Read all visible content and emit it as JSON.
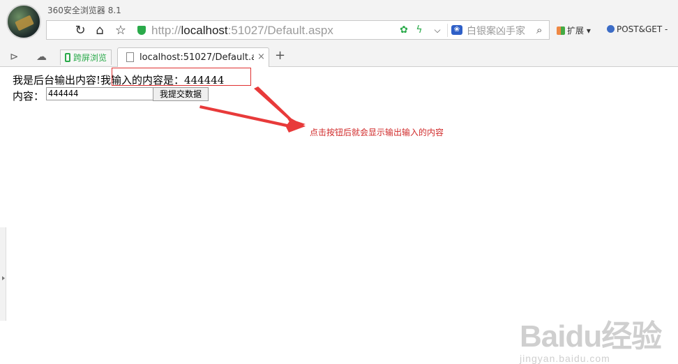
{
  "app": {
    "title": "360安全浏览器 8.1"
  },
  "toolbar": {
    "back_icon": "arrow-left-icon",
    "refresh_icon": "refresh-icon",
    "home_icon": "home-icon",
    "favorite_icon": "star-icon",
    "url_prefix": "http://",
    "url_host": "localhost",
    "url_rest": ":51027/Default.aspx",
    "search_placeholder": "白银案凶手家",
    "extensions_label": "扩展",
    "addon_label": "POST&GET -"
  },
  "tabs": {
    "green_label": "跨屏浏览",
    "active_label": "localhost:51027/Default.aspx",
    "close": "×",
    "new_tab": "+"
  },
  "page": {
    "output_text": "我是后台输出内容!",
    "echo_prefix": "我输入的内容是：",
    "echo_value": "444444",
    "content_label": "内容：",
    "input_value": "444444",
    "submit_label": "我提交数据"
  },
  "annotation": {
    "text": "点击按钮后就会显示输出输入的内容",
    "color": "#d02a2a"
  },
  "watermark": {
    "logo": "Baidu经验",
    "sub": "jingyan.baidu.com"
  }
}
